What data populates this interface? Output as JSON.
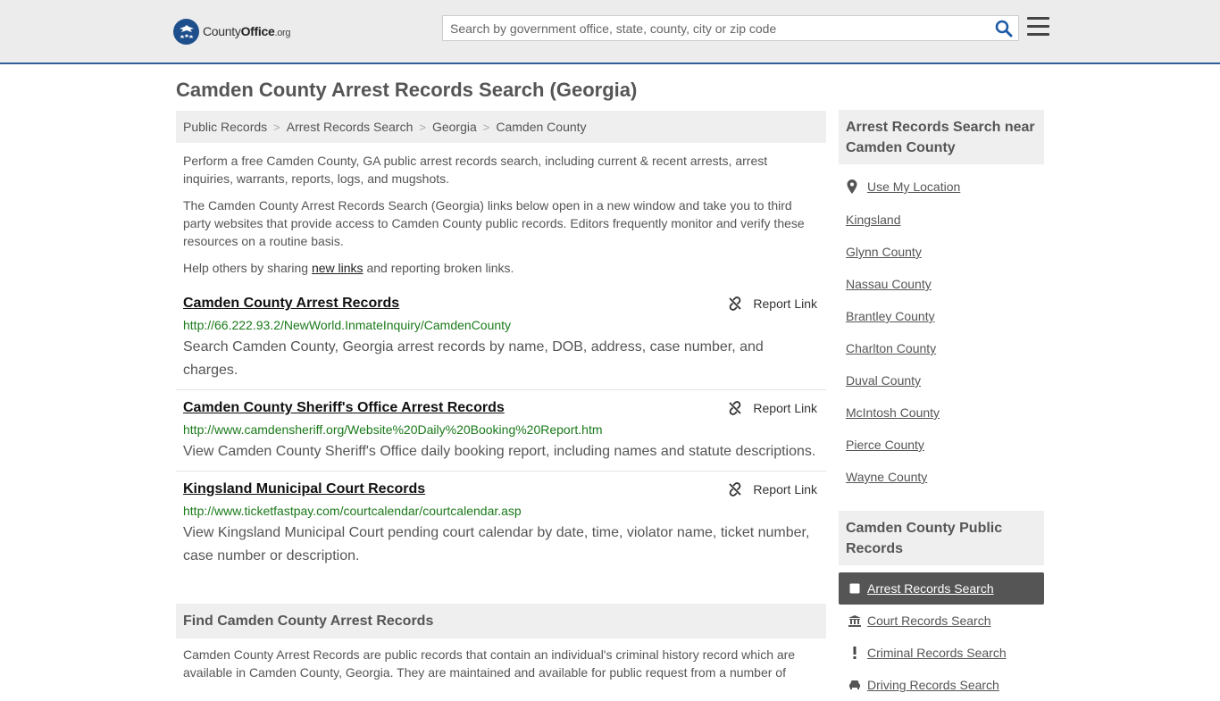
{
  "header": {
    "logo": {
      "name": "County",
      "name_bold": "Office",
      "tld": ".org"
    },
    "search": {
      "placeholder": "Search by government office, state, county, city or zip code",
      "value": ""
    },
    "accent_color": "#2f5f98"
  },
  "page_title": "Camden County Arrest Records Search (Georgia)",
  "breadcrumb": [
    "Public Records",
    "Arrest Records Search",
    "Georgia",
    "Camden County"
  ],
  "intro": {
    "p1": "Perform a free Camden County, GA public arrest records search, including current & recent arrests, arrest inquiries, warrants, reports, logs, and mugshots.",
    "p2": "The Camden County Arrest Records Search (Georgia) links below open in a new window and take you to third party websites that provide access to Camden County public records. Editors frequently monitor and verify these resources on a routine basis.",
    "p3_before": "Help others by sharing ",
    "p3_link": "new links",
    "p3_after": " and reporting broken links."
  },
  "report_label": "Report Link",
  "records": [
    {
      "title": "Camden County Arrest Records",
      "url": "http://66.222.93.2/NewWorld.InmateInquiry/CamdenCounty",
      "description": "Search Camden County, Georgia arrest records by name, DOB, address, case number, and charges."
    },
    {
      "title": "Camden County Sheriff's Office Arrest Records",
      "url": "http://www.camdensheriff.org/Website%20Daily%20Booking%20Report.htm",
      "description": "View Camden County Sheriff's Office daily booking report, including names and statute descriptions."
    },
    {
      "title": "Kingsland Municipal Court Records",
      "url": "http://www.ticketfastpay.com/courtcalendar/courtcalendar.asp",
      "description": "View Kingsland Municipal Court pending court calendar by date, time, violator name, ticket number, case number or description."
    }
  ],
  "find": {
    "heading": "Find Camden County Arrest Records",
    "text": "Camden County Arrest Records are public records that contain an individual's criminal history record which are available in Camden County, Georgia. They are maintained and available for public request from a number of"
  },
  "sidebar": {
    "nearby_heading": "Arrest Records Search near Camden County",
    "use_location": "Use My Location",
    "nearby": [
      "Kingsland",
      "Glynn County",
      "Nassau County",
      "Brantley County",
      "Charlton County",
      "Duval County",
      "McIntosh County",
      "Pierce County",
      "Wayne County"
    ],
    "public_heading": "Camden County Public Records",
    "public_items": [
      {
        "label": "Arrest Records Search",
        "icon": "square-icon",
        "active": true
      },
      {
        "label": "Court Records Search",
        "icon": "courthouse-icon",
        "active": false
      },
      {
        "label": "Criminal Records Search",
        "icon": "exclamation-icon",
        "active": false
      },
      {
        "label": "Driving Records Search",
        "icon": "car-icon",
        "active": false
      }
    ]
  }
}
